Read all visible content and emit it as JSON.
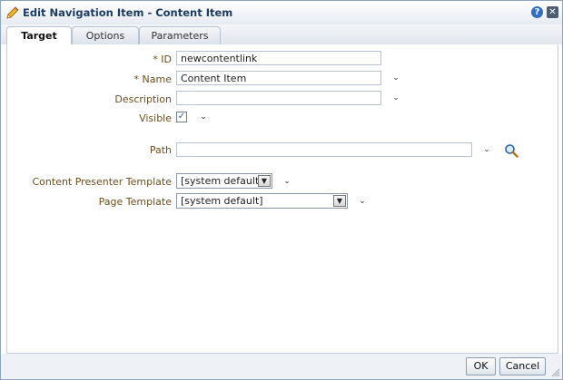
{
  "dialog": {
    "title": "Edit Navigation Item - Content Item",
    "help_label": "?",
    "close_label": "✕"
  },
  "tabs": [
    {
      "label": "Target",
      "active": true
    },
    {
      "label": "Options",
      "active": false
    },
    {
      "label": "Parameters",
      "active": false
    }
  ],
  "form": {
    "id": {
      "required_mark": "*",
      "label": "ID",
      "value": "newcontentlink"
    },
    "name": {
      "required_mark": "*",
      "label": "Name",
      "value": "Content Item"
    },
    "description": {
      "label": "Description",
      "value": ""
    },
    "visible": {
      "label": "Visible",
      "checked": true,
      "check_glyph": "✓"
    },
    "path": {
      "label": "Path",
      "value": ""
    },
    "content_presenter_template": {
      "label": "Content Presenter Template",
      "value": "[system default]"
    },
    "page_template": {
      "label": "Page Template",
      "value": "[system default]"
    }
  },
  "icons": {
    "chevron": "⌄",
    "select_arrow": "▼"
  },
  "buttons": {
    "ok": "OK",
    "cancel": "Cancel"
  },
  "colors": {
    "label": "#6b4f1e",
    "title": "#1d3c63",
    "help": "#2f6ec2"
  }
}
